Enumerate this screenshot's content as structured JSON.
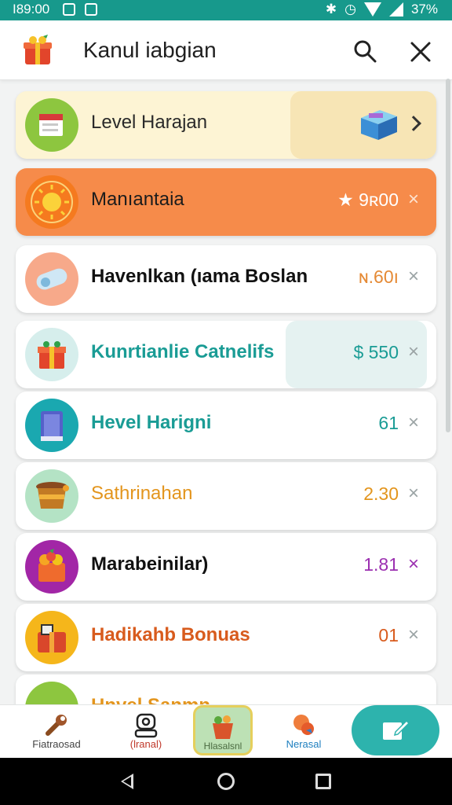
{
  "status_bar": {
    "time": "I89:00",
    "battery": "37%"
  },
  "header": {
    "title": "Kanul iabgian"
  },
  "list": [
    {
      "label": "Level Harajan",
      "value": "",
      "label_color": "#2a2a2a",
      "value_color": "#333333",
      "circle_color": "#8dc63f",
      "icon": "book-icon",
      "trailing": "chevron"
    },
    {
      "label": "Manıantaia",
      "value": "★ 9ʀ00",
      "label_color": "#1c1c1c",
      "value_color": "#ffffff",
      "circle_color": "#f57a1f",
      "icon": "sun-icon",
      "trailing": "x"
    },
    {
      "label": "Havenlkan (ıama Boslan",
      "value": "ɴ.60ı",
      "label_color": "#111111",
      "value_color": "#e58a35",
      "circle_color": "#f7a98a",
      "icon": "bandage-icon",
      "trailing": "x"
    },
    {
      "label": "Kunrtianlie Catnelifs",
      "value": "$ 550",
      "label_color": "#1a9c95",
      "value_color": "#1a9c95",
      "circle_color": "#d6eeec",
      "icon": "gift-icon",
      "trailing": "x"
    },
    {
      "label": "Hevel Harigni",
      "value": "61",
      "label_color": "#1a9c95",
      "value_color": "#1a9c95",
      "circle_color": "#1aa8b0",
      "icon": "book-icon",
      "trailing": "x"
    },
    {
      "label": "Sathrinahan",
      "value": "2.30",
      "label_color": "#e3951d",
      "value_color": "#e3951d",
      "circle_color": "#b4e3c5",
      "icon": "pot-icon",
      "trailing": "x"
    },
    {
      "label": "Marabeinilar)",
      "value": "1.81",
      "label_color": "#111111",
      "value_color": "#9b2fb0",
      "circle_color": "#a226a6",
      "icon": "gift-basket-icon",
      "trailing": "x"
    },
    {
      "label": "Hadikahb Bonuas",
      "value": "01",
      "label_color": "#d85b1d",
      "value_color": "#d85b1d",
      "circle_color": "#f5b61b",
      "icon": "gift-icon",
      "trailing": "x"
    },
    {
      "label": "Hnvel Sanmn",
      "value": "",
      "label_color": "#e3951d",
      "value_color": "#e3951d",
      "circle_color": "#8dc63f",
      "icon": "food-icon",
      "trailing": ""
    }
  ],
  "bottom_nav": [
    {
      "label": "Fiatraosad",
      "icon": "wrench-icon"
    },
    {
      "label": "(lranal)",
      "icon": "robot-icon"
    },
    {
      "label": "Hlasalsnl",
      "icon": "basket-icon"
    },
    {
      "label": "Nerasal",
      "icon": "bag-icon"
    },
    {
      "label": "",
      "icon": "edit-icon"
    }
  ]
}
